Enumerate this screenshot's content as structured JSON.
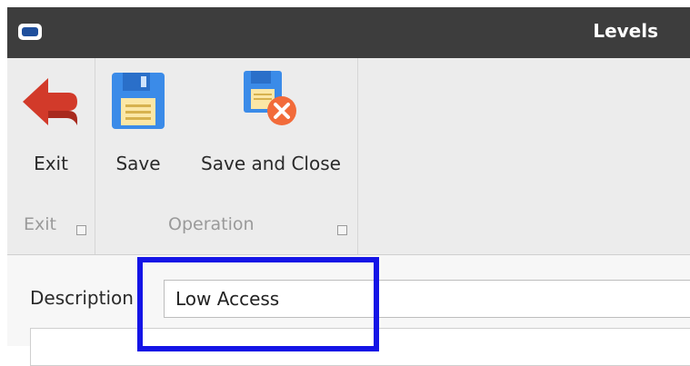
{
  "window": {
    "title": "Levels"
  },
  "ribbon": {
    "groups": [
      {
        "name": "Exit",
        "buttons": [
          {
            "label": "Exit",
            "icon": "exit-arrow-icon"
          }
        ]
      },
      {
        "name": "Operation",
        "buttons": [
          {
            "label": "Save",
            "icon": "save-icon"
          },
          {
            "label": "Save and Close",
            "icon": "save-close-icon"
          }
        ]
      }
    ]
  },
  "form": {
    "description_label": "Description",
    "description_value": "Low Access"
  },
  "colors": {
    "titlebar": "#3d3d3d",
    "ribbon": "#ececec",
    "highlight": "#1414e6",
    "exit_arrow": "#d23a2a",
    "save_blue": "#3b8be8"
  }
}
